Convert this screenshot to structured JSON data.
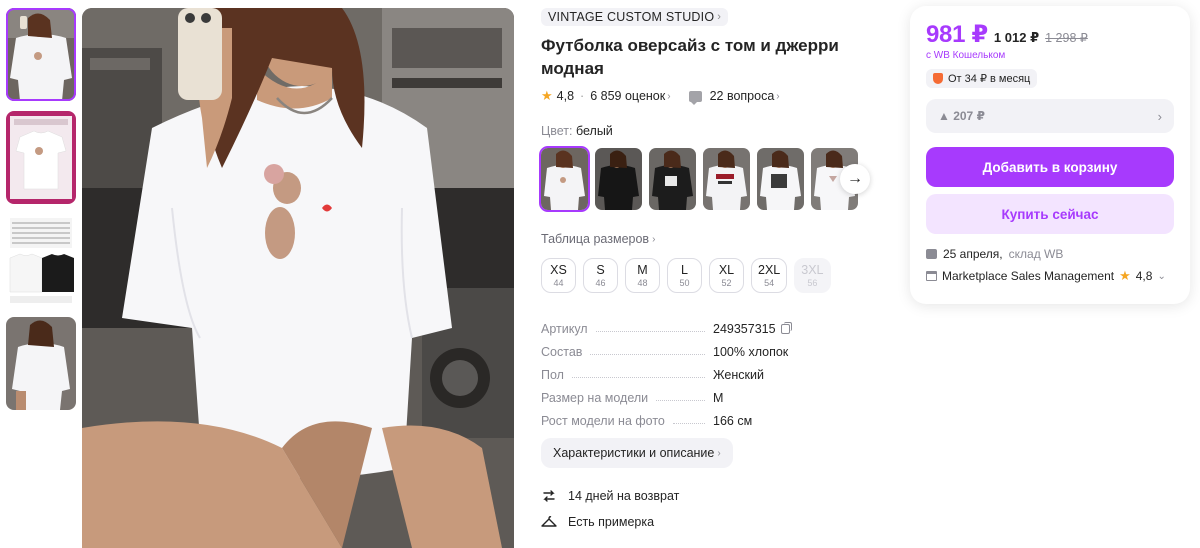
{
  "product": {
    "brand": "VINTAGE CUSTOM STUDIO",
    "title": "Футболка оверсайз с том и джерри модная",
    "rating": "4,8",
    "reviews": "6 859 оценок",
    "questions": "22 вопроса"
  },
  "color": {
    "label": "Цвет:",
    "value": "белый"
  },
  "sizes": {
    "table_link": "Таблица размеров",
    "items": [
      {
        "size": "XS",
        "ru": "44",
        "available": true
      },
      {
        "size": "S",
        "ru": "46",
        "available": true
      },
      {
        "size": "M",
        "ru": "48",
        "available": true
      },
      {
        "size": "L",
        "ru": "50",
        "available": true
      },
      {
        "size": "XL",
        "ru": "52",
        "available": true
      },
      {
        "size": "2XL",
        "ru": "54",
        "available": true
      },
      {
        "size": "3XL",
        "ru": "56",
        "available": false
      }
    ]
  },
  "specs": [
    {
      "key": "Артикул",
      "value": "249357315"
    },
    {
      "key": "Состав",
      "value": "100% хлопок"
    },
    {
      "key": "Пол",
      "value": "Женский"
    },
    {
      "key": "Размер на модели",
      "value": "M"
    },
    {
      "key": "Рост модели на фото",
      "value": "166 см"
    }
  ],
  "characteristics_button": "Характеристики и описание",
  "perks": [
    {
      "icon": "return-icon",
      "text": "14 дней на возврат"
    },
    {
      "icon": "hanger-icon",
      "text": "Есть примерка"
    }
  ],
  "price": {
    "wallet_price": "981 ₽",
    "price": "1 012 ₽",
    "old_price": "1 298 ₽",
    "wallet_note": "с WB Кошельком",
    "installment": "От 34 ₽ в месяц",
    "promo": "▲ 207 ₽"
  },
  "buttons": {
    "add_to_cart": "Добавить в корзину",
    "buy_now": "Купить сейчас"
  },
  "delivery": {
    "date": "25 апреля,",
    "warehouse": "склад WB"
  },
  "seller": {
    "name": "Marketplace Sales Management",
    "rating": "4,8"
  },
  "colors": {
    "accent": "#a73afd",
    "accent_light": "#f3e4ff",
    "chip_bg": "#f2f2f6"
  }
}
